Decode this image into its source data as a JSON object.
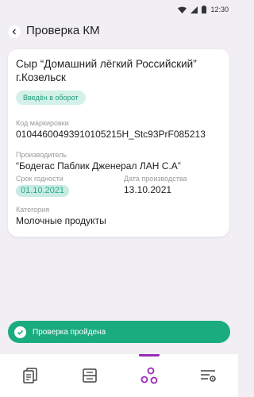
{
  "status_bar": {
    "time": "12:30"
  },
  "header": {
    "title": "Проверка КМ"
  },
  "card": {
    "product_name": "Сыр “Домашний лёгкий Российский” г.Козельск",
    "status_badge": "Введён в оборот",
    "code_label": "Код маркировки",
    "code_value": "0104460049391010521​5H_Stc93PrF085213",
    "producer_label": "Производитель",
    "producer_value": "“Бодегас Паблик Дженерал ЛАН С.А”",
    "expiry_label": "Срок годности",
    "expiry_value": "01.10.2021",
    "production_label": "Дата производства",
    "production_value": "13.10.2021",
    "category_label": "Категория",
    "category_value": "Молочные продукты"
  },
  "toast": {
    "text": "Проверка пройдена"
  },
  "bottom_nav": {
    "items": [
      {
        "icon": "documents-icon"
      },
      {
        "icon": "list-icon"
      },
      {
        "icon": "scan-check-icon",
        "active": true
      },
      {
        "icon": "settings-icon"
      }
    ]
  },
  "colors": {
    "accent": "#9b27b9",
    "success": "#1bac7e",
    "badge_bg": "#d3f1e8",
    "background": "#f1eff3"
  }
}
